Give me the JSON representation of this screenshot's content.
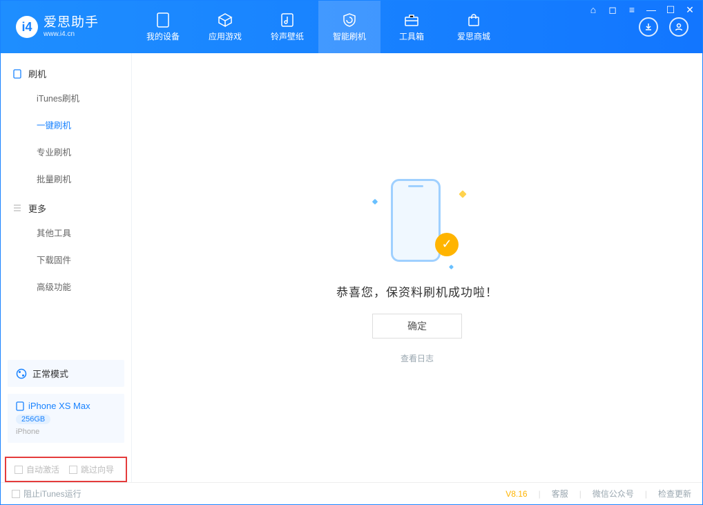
{
  "brand": {
    "title": "爱思助手",
    "sub": "www.i4.cn"
  },
  "titlebar_icons": [
    "shirt",
    "square",
    "menu",
    "min",
    "max",
    "close"
  ],
  "nav": [
    {
      "label": "我的设备",
      "icon": "device"
    },
    {
      "label": "应用游戏",
      "icon": "cube"
    },
    {
      "label": "铃声壁纸",
      "icon": "music"
    },
    {
      "label": "智能刷机",
      "icon": "shield",
      "active": true
    },
    {
      "label": "工具箱",
      "icon": "toolbox"
    },
    {
      "label": "爱思商城",
      "icon": "bag"
    }
  ],
  "sidebar": {
    "group1": {
      "title": "刷机",
      "items": [
        "iTunes刷机",
        "一键刷机",
        "专业刷机",
        "批量刷机"
      ],
      "active_index": 1
    },
    "group2": {
      "title": "更多",
      "items": [
        "其他工具",
        "下载固件",
        "高级功能"
      ]
    }
  },
  "mode_card": {
    "label": "正常模式"
  },
  "device_card": {
    "name": "iPhone XS Max",
    "storage": "256GB",
    "sub": "iPhone"
  },
  "highlight": {
    "opt1": "自动激活",
    "opt2": "跳过向导"
  },
  "main": {
    "message": "恭喜您，保资料刷机成功啦！",
    "ok": "确定",
    "log_link": "查看日志"
  },
  "footer": {
    "block_itunes": "阻止iTunes运行",
    "version": "V8.16",
    "links": [
      "客服",
      "微信公众号",
      "检查更新"
    ]
  }
}
